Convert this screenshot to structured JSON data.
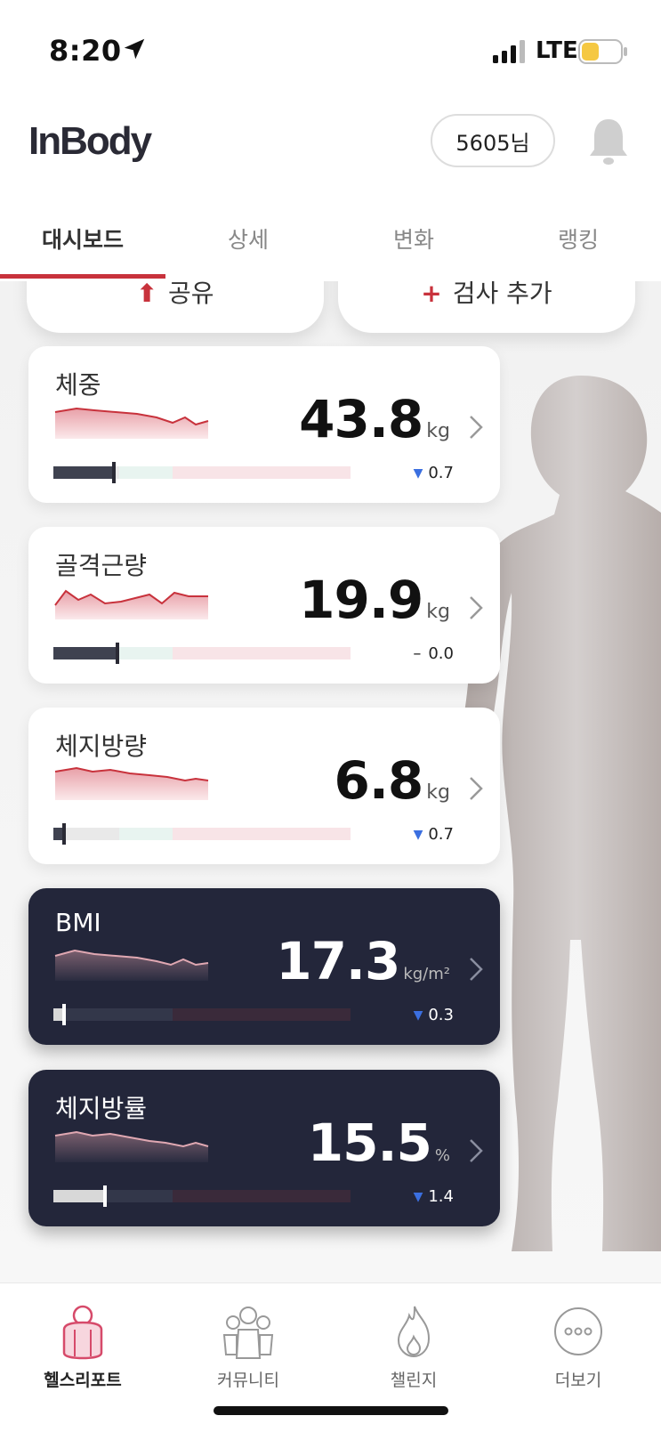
{
  "status": {
    "time": "8:20",
    "location_icon": "location-arrow-icon",
    "signal_icon": "cellular-signal-icon",
    "network": "LTE",
    "battery_icon": "battery-icon",
    "battery_level": 0.45
  },
  "header": {
    "logo": "InBody",
    "user": "5605님",
    "bell_icon": "bell-icon"
  },
  "tabs": [
    {
      "label": "대시보드",
      "active": true
    },
    {
      "label": "상세",
      "active": false
    },
    {
      "label": "변화",
      "active": false
    },
    {
      "label": "랭킹",
      "active": false
    }
  ],
  "top_buttons": [
    {
      "label": "공유",
      "icon": "share-icon"
    },
    {
      "label": "검사 추가",
      "icon": "plus-icon"
    }
  ],
  "cards": [
    {
      "title": "체중",
      "value": "43.8",
      "unit": "kg",
      "change": "0.7",
      "trend": "down",
      "theme": "light",
      "level": 0.2
    },
    {
      "title": "골격근량",
      "value": "19.9",
      "unit": "kg",
      "change": "0.0",
      "trend": "flat",
      "theme": "light",
      "level": 0.21
    },
    {
      "title": "체지방량",
      "value": "6.8",
      "unit": "kg",
      "change": "0.7",
      "trend": "down",
      "theme": "light",
      "level": 0.03
    },
    {
      "title": "BMI",
      "value": "17.3",
      "unit": "kg/m²",
      "change": "0.3",
      "trend": "down",
      "theme": "dark",
      "level": 0.03
    },
    {
      "title": "체지방률",
      "value": "15.5",
      "unit": "%",
      "change": "1.4",
      "trend": "down",
      "theme": "dark",
      "level": 0.17
    }
  ],
  "bottom_nav": [
    {
      "label": "헬스리포트",
      "icon": "health-report-icon",
      "active": true
    },
    {
      "label": "커뮤니티",
      "icon": "community-icon",
      "active": false
    },
    {
      "label": "챌린지",
      "icon": "flame-icon",
      "active": false
    },
    {
      "label": "더보기",
      "icon": "more-icon",
      "active": false
    }
  ],
  "colors": {
    "accent": "#c8323c",
    "dark_card": "#23263a",
    "trend_down": "#3b6fe0"
  }
}
